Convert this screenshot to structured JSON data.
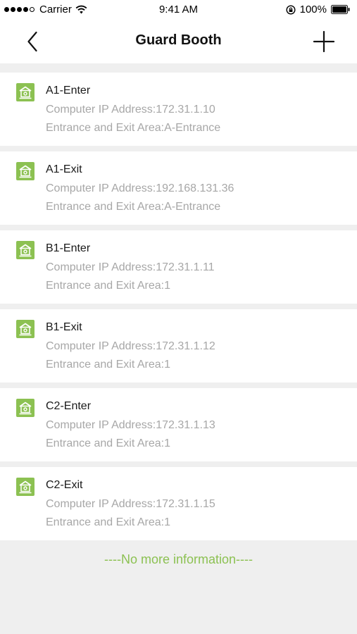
{
  "status_bar": {
    "carrier": "Carrier",
    "time": "9:41 AM",
    "battery": "100%"
  },
  "nav": {
    "title": "Guard Booth",
    "back_icon": "chevron-left-icon",
    "add_icon": "plus-icon"
  },
  "colors": {
    "accent": "#8cc152",
    "icon_bg": "#8cc152",
    "secondary_text": "#a7a7a7",
    "background": "#efefef"
  },
  "booths": [
    {
      "name": "A1-Enter",
      "ip": "Computer IP Address:172.31.1.10",
      "area": "Entrance and Exit Area:A-Entrance"
    },
    {
      "name": "A1-Exit",
      "ip": "Computer IP Address:192.168.131.36",
      "area": "Entrance and Exit Area:A-Entrance"
    },
    {
      "name": "B1-Enter",
      "ip": "Computer IP Address:172.31.1.11",
      "area": "Entrance and Exit Area:1"
    },
    {
      "name": "B1-Exit",
      "ip": "Computer IP Address:172.31.1.12",
      "area": "Entrance and Exit Area:1"
    },
    {
      "name": "C2-Enter",
      "ip": "Computer IP Address:172.31.1.13",
      "area": "Entrance and Exit Area:1"
    },
    {
      "name": "C2-Exit",
      "ip": "Computer IP Address:172.31.1.15",
      "area": "Entrance and Exit Area:1"
    }
  ],
  "footer": {
    "no_more": "----No more information----"
  }
}
